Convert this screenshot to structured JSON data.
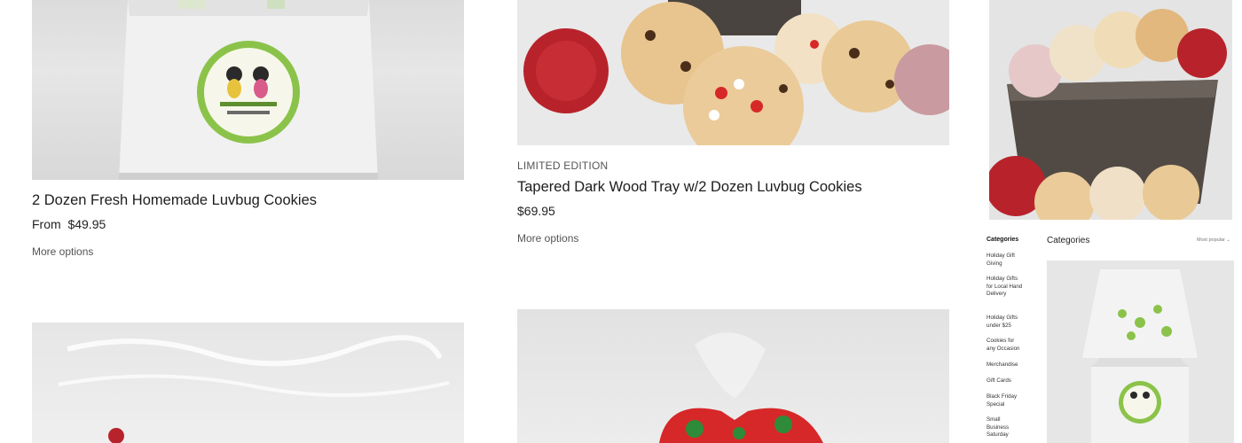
{
  "products": [
    {
      "title": "2 Dozen Fresh Homemade Luvbug Cookies",
      "price_prefix": "From",
      "price": "$49.95",
      "more_options": "More options",
      "sticker_text": "Luvbug Cookie Company"
    },
    {
      "badge": "LIMITED EDITION",
      "title": "Tapered Dark Wood Tray w/2 Dozen Luvbug Cookies",
      "price": "$69.95",
      "more_options": "More options"
    }
  ],
  "mini_page": {
    "categories_heading": "Categories",
    "categories": [
      "Holiday Gift Giving",
      "Holiday Gifts for Local Hand Delivery",
      "Holiday Gifts under $25",
      "Cookies for any Occasion",
      "Merchandise",
      "Gift Cards",
      "Black Friday Special",
      "Small Business Saturday"
    ],
    "title": "Categories",
    "sort_label": "Most popular",
    "sticker_text": "Luvbug Cookie Company"
  },
  "colors": {
    "text": "#222222",
    "muted": "#555555",
    "sticker_green": "#8bc34a",
    "ribbon_red": "#d62828",
    "wood": "#4a4440"
  }
}
